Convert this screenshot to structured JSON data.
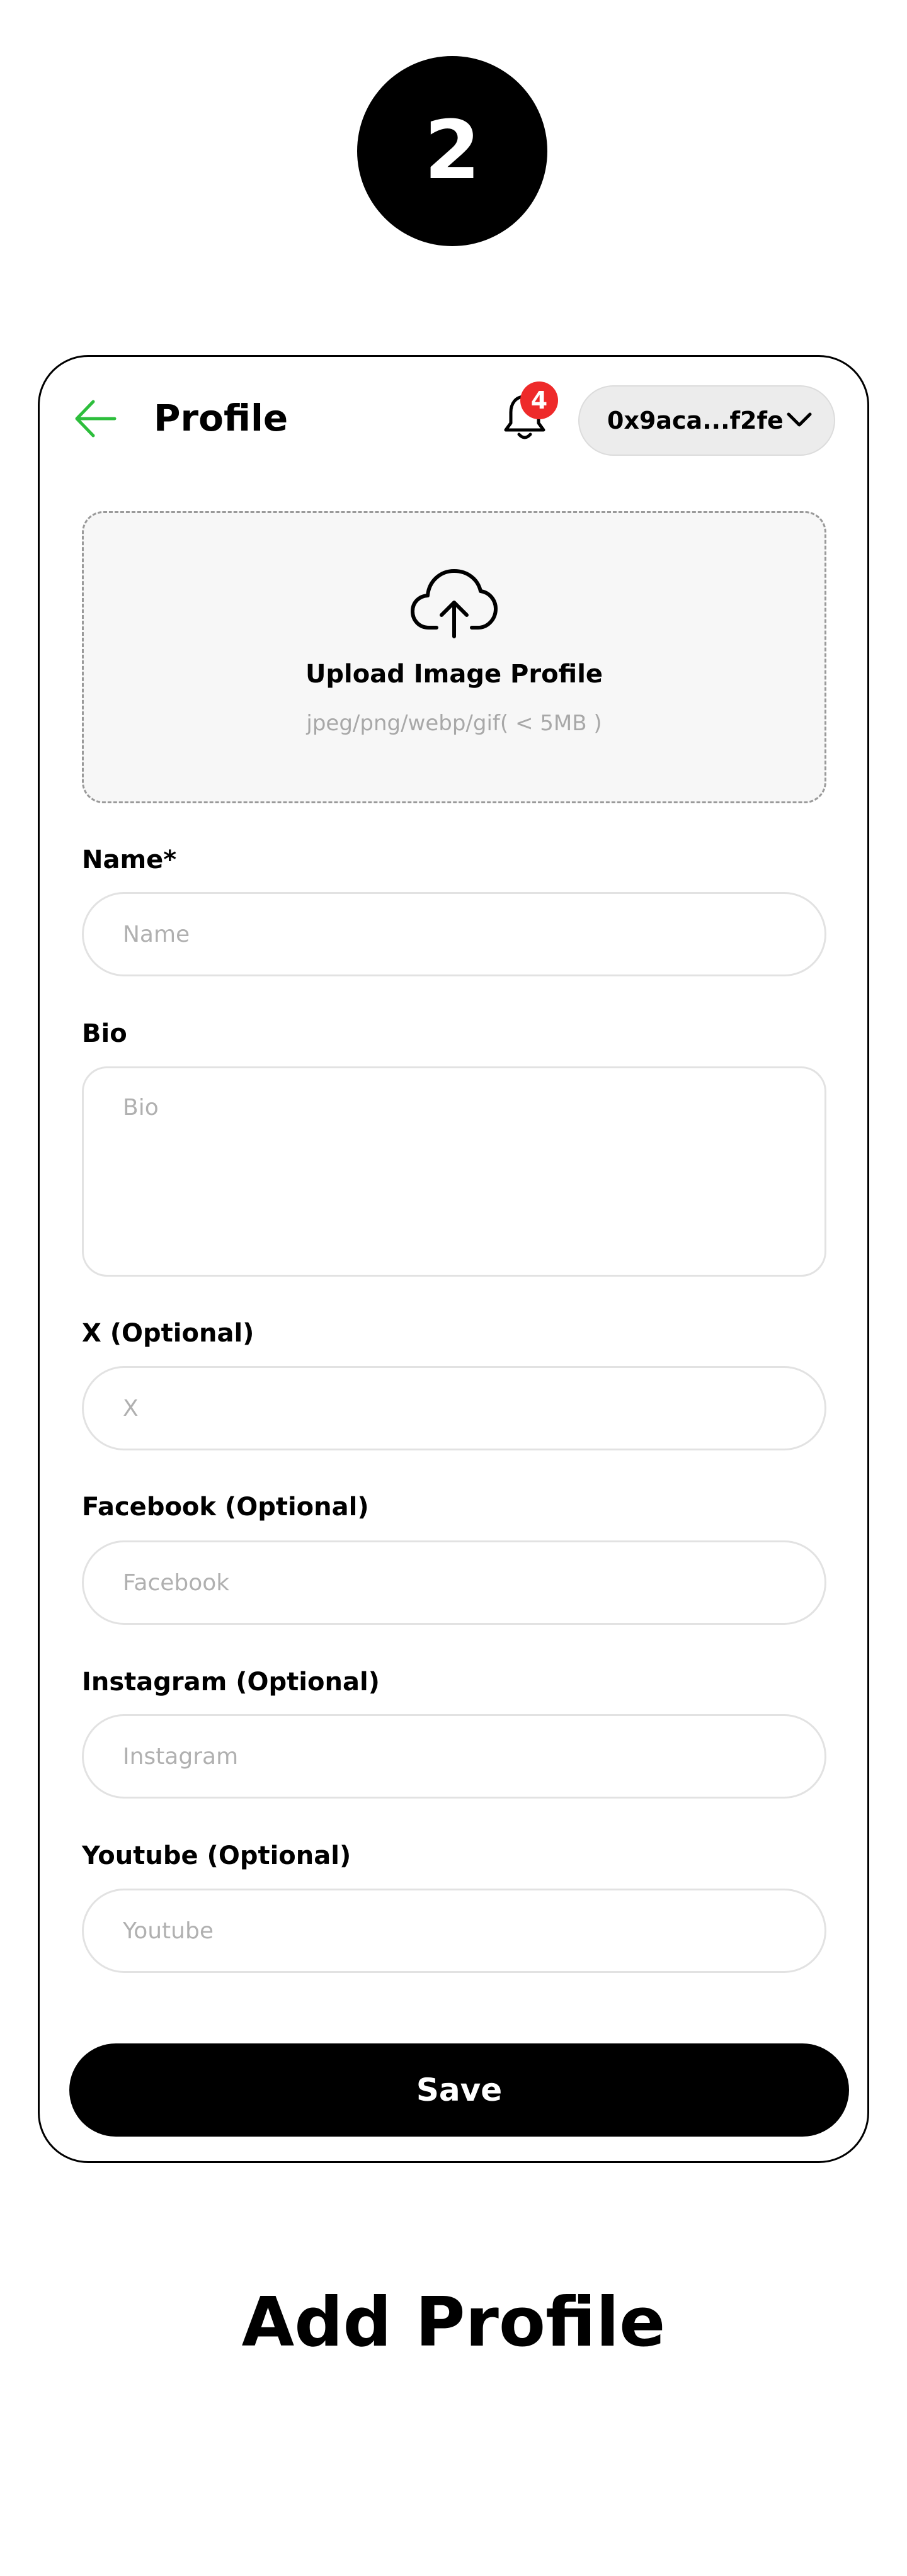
{
  "step_number": "2",
  "header": {
    "title": "Profile",
    "notification_count": "4",
    "wallet_address": "0x9aca...f2fe"
  },
  "upload": {
    "title": "Upload Image Profile",
    "hint": "jpeg/png/webp/gif( < 5MB )"
  },
  "fields": {
    "name": {
      "label": "Name*",
      "placeholder": "Name"
    },
    "bio": {
      "label": "Bio",
      "placeholder": "Bio"
    },
    "x": {
      "label": "X (Optional)",
      "placeholder": "X"
    },
    "facebook": {
      "label": "Facebook (Optional)",
      "placeholder": "Facebook"
    },
    "instagram": {
      "label": "Instagram (Optional)",
      "placeholder": "Instagram"
    },
    "youtube": {
      "label": "Youtube (Optional)",
      "placeholder": "Youtube"
    }
  },
  "save_label": "Save",
  "caption": "Add Profile",
  "icons": {
    "back": "arrow-left-icon",
    "notifications": "bell-icon",
    "wallet_dropdown": "chevron-down-icon",
    "upload": "cloud-upload-icon"
  },
  "colors": {
    "accent": "#2dbe3c",
    "badge": "#ee2a2a",
    "primary": "#000000"
  }
}
